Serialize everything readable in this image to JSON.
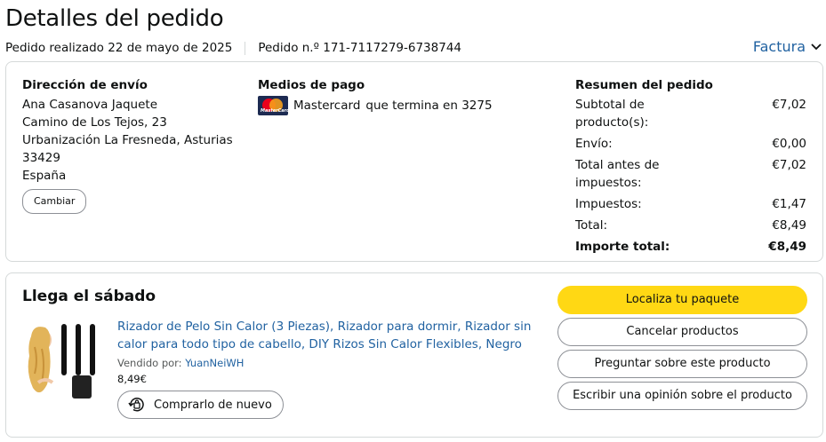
{
  "header": {
    "title": "Detalles del pedido",
    "order_date": "Pedido realizado 22 de mayo de 2025",
    "order_number": "Pedido n.º 171-7117279-6738744",
    "invoice_label": "Factura"
  },
  "shipping": {
    "heading": "Dirección de envío",
    "lines": [
      "Ana Casanova Jaquete",
      "Camino de Los Tejos, 23",
      "Urbanización La Fresneda, Asturias",
      "33429",
      "España"
    ],
    "change_label": "Cambiar"
  },
  "payment": {
    "heading": "Medios de pago",
    "card_brand_text": "MasterCard",
    "method": "Mastercard",
    "ending": "que termina en 3275"
  },
  "summary": {
    "heading": "Resumen del pedido",
    "rows": [
      {
        "label": "Subtotal de producto(s):",
        "value": "€7,02"
      },
      {
        "label": "Envío:",
        "value": "€0,00"
      },
      {
        "label": "Total antes de impuestos:",
        "value": "€7,02"
      },
      {
        "label": "Impuestos:",
        "value": "€1,47"
      },
      {
        "label": "Total:",
        "value": "€8,49"
      },
      {
        "label": "Importe total:",
        "value": "€8,49"
      }
    ]
  },
  "delivery": {
    "title": "Llega el sábado",
    "product_title": "Rizador de Pelo Sin Calor (3 Piezas), Rizador para dormir, Rizador sin calor para todo tipo de cabello, DIY Rizos Sin Calor Flexibles, Negro",
    "sold_by_label": "Vendido por:",
    "seller": "YuanNeiWH",
    "price": "8,49€",
    "buy_again_label": "Comprarlo de nuevo"
  },
  "actions": {
    "track": "Localiza tu paquete",
    "cancel": "Cancelar productos",
    "ask": "Preguntar sobre este producto",
    "review": "Escribir una opinión sobre el producto"
  },
  "colors": {
    "link": "#2162a1",
    "primary_button": "#ffd814",
    "border": "#d5d9d9"
  }
}
